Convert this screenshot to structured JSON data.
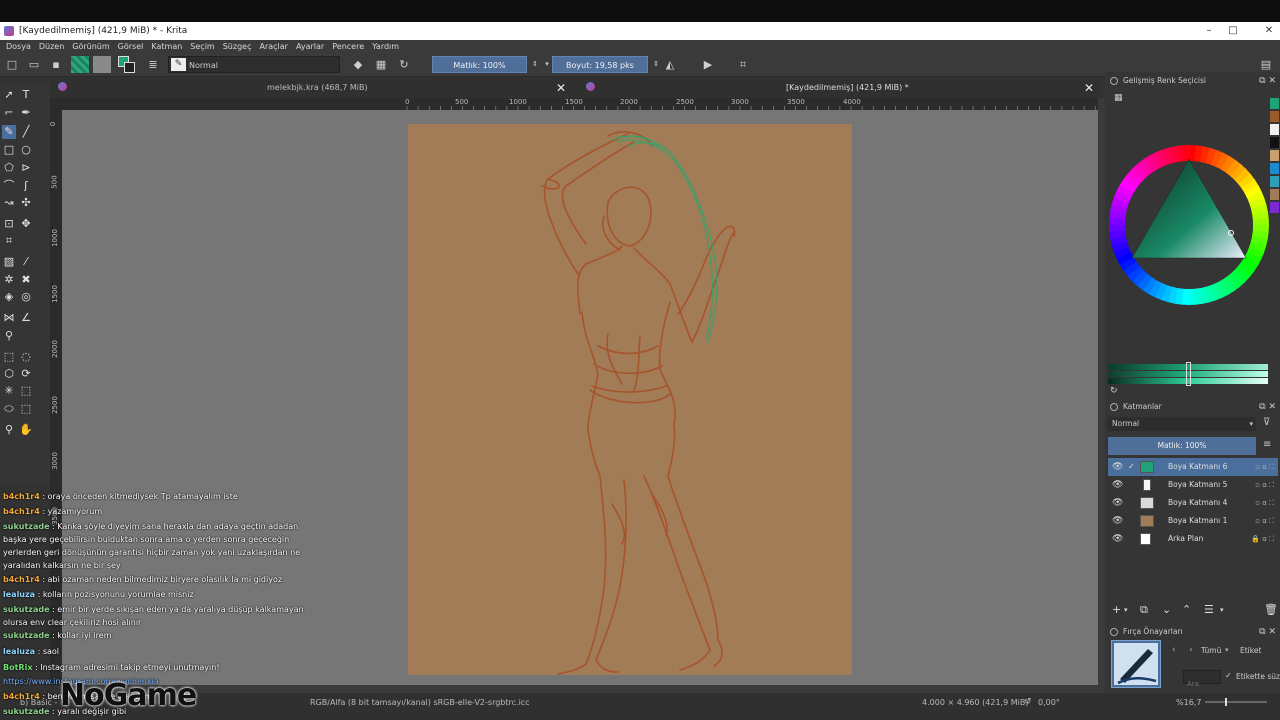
{
  "window": {
    "title": "[Kaydedilmemiş]  (421,9 MiB) * - Krita",
    "controls": [
      "–",
      "□",
      "⧉",
      "✕"
    ]
  },
  "menu": [
    "Dosya",
    "Düzen",
    "Görünüm",
    "Görsel",
    "Katman",
    "Seçim",
    "Süzgeç",
    "Araçlar",
    "Ayarlar",
    "Pencere",
    "Yardım"
  ],
  "toolbar": {
    "blend_mode": "Normal",
    "opacity": "Matlık: 100%",
    "size": "Boyut: 19,58 pks"
  },
  "tabs": [
    {
      "label": "melekbjk.kra (468,7 MiB)",
      "close": "✕"
    },
    {
      "label": "[Kaydedilmemiş]  (421,9 MiB) *",
      "close": "✕"
    }
  ],
  "ruler": {
    "top": [
      "0",
      "500",
      "1000",
      "1500",
      "2000",
      "2500",
      "3000",
      "3500",
      "4000"
    ],
    "left": [
      "0",
      "500",
      "1000",
      "1500",
      "2000",
      "2500",
      "3000",
      "3500"
    ]
  },
  "color_selector": {
    "title": "Gelişmiş Renk Seçicisi",
    "swatches": [
      "#1fa37a",
      "#9a5a2c",
      "#f0f0f0",
      "#111111",
      "#c8a070",
      "#1e8bd0",
      "#2d9fb8",
      "#a27c56",
      "#7a2ad0"
    ]
  },
  "layers": {
    "title": "Katmanlar",
    "blend": "Normal",
    "opacity": "Matlık:  100%",
    "items": [
      {
        "name": "Boya Katmanı 6",
        "thumb": "#1fa37a",
        "selected": true
      },
      {
        "name": "Boya Katmanı 5",
        "thumb": "#f4f4f4",
        "selected": false
      },
      {
        "name": "Boya Katmanı 4",
        "thumb": "#d9d9d9",
        "selected": false
      },
      {
        "name": "Boya Katmanı 1",
        "thumb": "#a27c56",
        "selected": false
      },
      {
        "name": "Arka Plan",
        "thumb": "#ffffff",
        "selected": false
      }
    ]
  },
  "brush_presets": {
    "title": "Fırça Önayarları",
    "filter": "Tümü",
    "tag_label": "Etiket",
    "search_placeholder": "Ara",
    "tag_search": "Etikette süz"
  },
  "status": {
    "brush": "b) Basic -",
    "colorspace": "RGB/Alfa (8 bit tamsayı/kanal) sRGB-elle-V2-srgbtrc.icc",
    "dimensions": "4.000 × 4.960 (421,9 MiB)",
    "rotation": "0,00°",
    "zoom": "%16,7"
  },
  "chat": [
    {
      "user": "b4ch1r4",
      "color": "#f2a83a",
      "text": " : oraya önceden kitmediysek Tp atamayalım iste"
    },
    {
      "user": "b4ch1r4",
      "color": "#f2a83a",
      "text": " : yazamıyorum"
    },
    {
      "user": "sukutzade",
      "color": "#8fd18f",
      "text": " : Kanka şöyle diyeyim sana heraxla dan adaya geçtin adadan başka yere geçebilirsin bulduktan sonra ama o yerden sonra geçeceğin yerlerden geri dönüşünün garantisi hiçbir zaman yok yani uzaklaşırdan ne yaralıdan kalkarsın ne bir şey"
    },
    {
      "user": "b4ch1r4",
      "color": "#f2a83a",
      "text": " : abi ozaman neden bilmedimiz biryere olasılık la mi gidiyoz"
    },
    {
      "user": "lealuza",
      "color": "#8fd6ff",
      "text": " : kolların pozisyonunu yorumlae misniz"
    },
    {
      "user": "sukutzade",
      "color": "#8fd18f",
      "text": " : emir bir yerde sıkışan eden ya da yaralıya düşüp kalkamayan olursa env clear çekiliriz hosi alınır"
    },
    {
      "user": "sukutzade",
      "color": "#8fd18f",
      "text": " : kollar iyi irem"
    },
    {
      "user": "lealuza",
      "color": "#8fd6ff",
      "text": " : saol"
    },
    {
      "user": "BotRix",
      "color": "#6fe06f",
      "text": " : Instagram adresimi takip etmeyi unutmayın!"
    },
    {
      "user": "",
      "color": "#7ab3ff",
      "text": "https://www.instagram.com/wachenxia"
    },
    {
      "user": "b4ch1r4",
      "color": "#f2a83a",
      "text": " : ben yarım saat e gelecem"
    },
    {
      "user": "sukutzade",
      "color": "#8fd18f",
      "text": " : yaralı değişir gibi"
    }
  ],
  "watermark": "NoGame"
}
